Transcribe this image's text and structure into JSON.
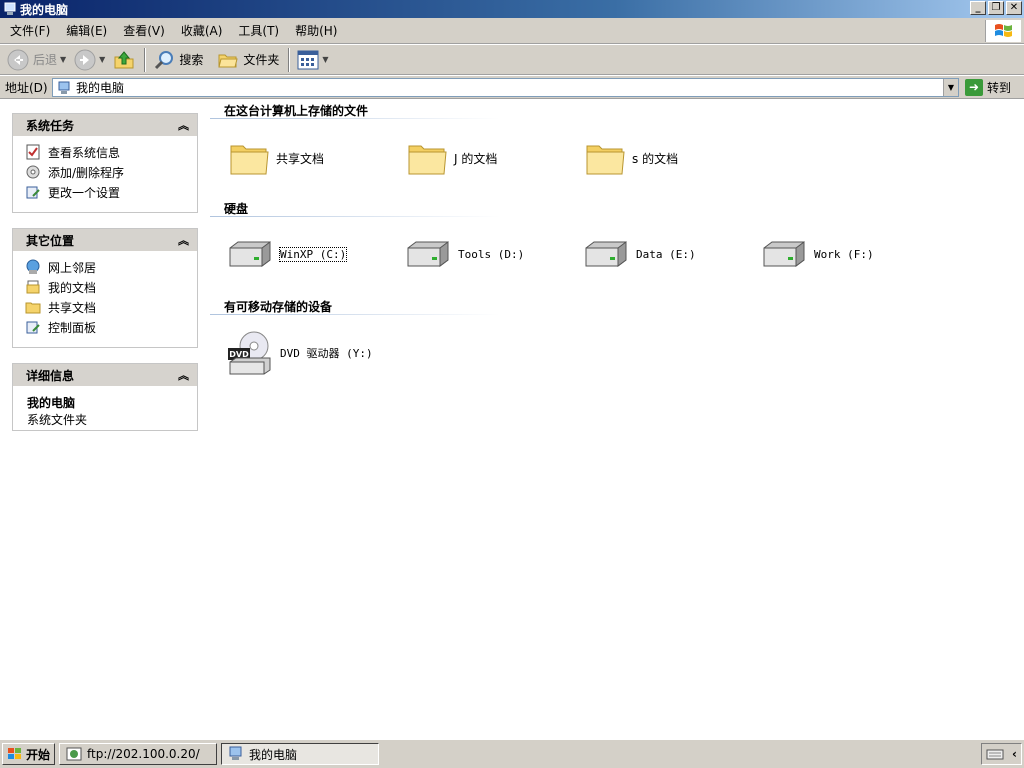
{
  "window": {
    "title": "我的电脑"
  },
  "menubar": {
    "items": [
      "文件(F)",
      "编辑(E)",
      "查看(V)",
      "收藏(A)",
      "工具(T)",
      "帮助(H)"
    ]
  },
  "toolbar": {
    "back_label": "后退",
    "search_label": "搜索",
    "folders_label": "文件夹"
  },
  "address": {
    "label": "地址(D)",
    "value": "我的电脑",
    "go_label": "转到"
  },
  "sidebar": {
    "system_tasks": {
      "title": "系统任务",
      "items": [
        "查看系统信息",
        "添加/删除程序",
        "更改一个设置"
      ]
    },
    "other_places": {
      "title": "其它位置",
      "items": [
        "网上邻居",
        "我的文档",
        "共享文档",
        "控制面板"
      ]
    },
    "details": {
      "title": "详细信息",
      "name": "我的电脑",
      "type": "系统文件夹"
    }
  },
  "main": {
    "groups": [
      {
        "title": "在这台计算机上存储的文件",
        "items": [
          "共享文档",
          "J 的文档",
          "s 的文档"
        ]
      },
      {
        "title": "硬盘",
        "items": [
          "WinXP (C:)",
          "Tools (D:)",
          "Data (E:)",
          "Work (F:)"
        ]
      },
      {
        "title": "有可移动存储的设备",
        "items": [
          "DVD 驱动器 (Y:)"
        ]
      }
    ]
  },
  "taskbar": {
    "start_label": "开始",
    "tasks": [
      "ftp://202.100.0.20/",
      "我的电脑"
    ],
    "active_task": "我的电脑"
  },
  "colors": {
    "titlebar_dark": "#0a246a",
    "titlebar_light": "#a6caf0",
    "chrome": "#d4d0c8",
    "panel_head": "#d6d3ce"
  }
}
